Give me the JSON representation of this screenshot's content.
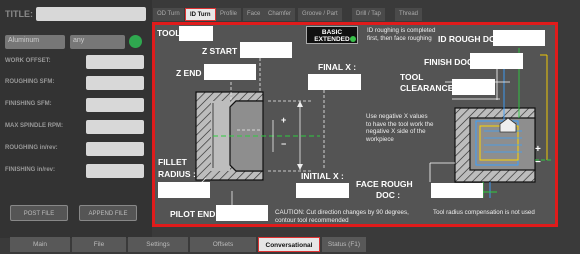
{
  "left_panel": {
    "title_label": "TITLE:",
    "material": "Aluminum",
    "mode": "any",
    "fields": [
      "WORK OFFSET:",
      "ROUGHING SFM:",
      "FINISHING SFM:",
      "MAX SPINDLE RPM:",
      "ROUGHING in/rev:",
      "FINISHING in/rev:"
    ],
    "post_file": "POST FILE",
    "append_file": "APPEND FILE"
  },
  "top_tabs": [
    "OD Turn",
    "ID Turn",
    "Profile",
    "Face",
    "Chamfer",
    "Groove / Part",
    "Drill / Tap",
    "Thread"
  ],
  "active_top_tab": "ID Turn",
  "bottom_tabs": [
    "Main",
    "File",
    "Settings",
    "Offsets",
    "Conversational",
    "Status (F1)"
  ],
  "active_bottom_tab": "Conversational",
  "form": {
    "tool": "TOOL :",
    "z_start": "Z START :",
    "z_end": "Z END :",
    "final_x": "FINAL X :",
    "id_rough_doc": "ID ROUGH DOC :",
    "finish_doc": "FINISH DOC :",
    "tool_clearance": [
      "TOOL",
      "CLEARANCE :"
    ],
    "fillet_radius": [
      "FILLET",
      "RADIUS :"
    ],
    "initial_x": "INITIAL X :",
    "face_rough_doc": [
      "FACE ROUGH",
      "DOC :"
    ],
    "pilot_end": "PILOT END :"
  },
  "toggle": {
    "line1": "BASIC",
    "line2": "EXTENDED"
  },
  "notes": {
    "id_roughing": "ID roughing is completed first, then face roughing",
    "negative_x": "Use negative X values to have the tool work the negative X side of the workpiece",
    "caution": "CAUTION: Cut direction changes by 90 degrees, contour tool recommended",
    "tool_radius": "Tool radius compensation is not used"
  },
  "symbols": {
    "plus": "+",
    "minus": "−"
  },
  "colors": {
    "accent_red": "#e01b1b",
    "green_led": "#39c24a",
    "panel": "#545454"
  }
}
